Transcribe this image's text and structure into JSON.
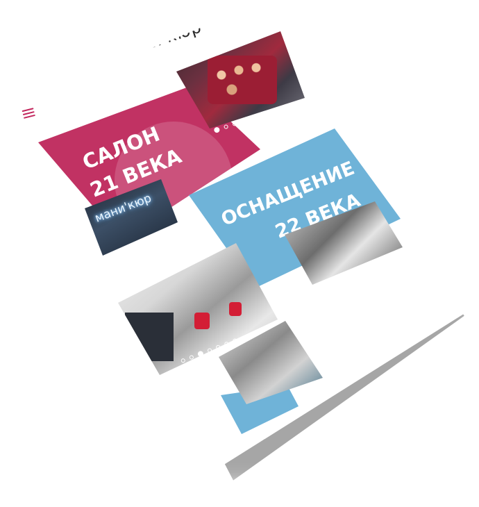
{
  "brand": {
    "logo_text": "мани'кюр",
    "neon_sign_text": "мани'кюр"
  },
  "header": {
    "menu_icon": "hamburger-menu-icon"
  },
  "sections": [
    {
      "heading_line1": "САЛОН",
      "heading_line2": "21 ВЕКА",
      "color": "#c13263"
    },
    {
      "heading_line1": "ОСНАЩЕНИЕ",
      "heading_line2": "22 ВЕКА",
      "color": "#6fb3d8"
    }
  ],
  "sliders": [
    {
      "dot_count": 9,
      "active_index": 0
    },
    {
      "dot_count": 7,
      "active_index": 2
    }
  ]
}
